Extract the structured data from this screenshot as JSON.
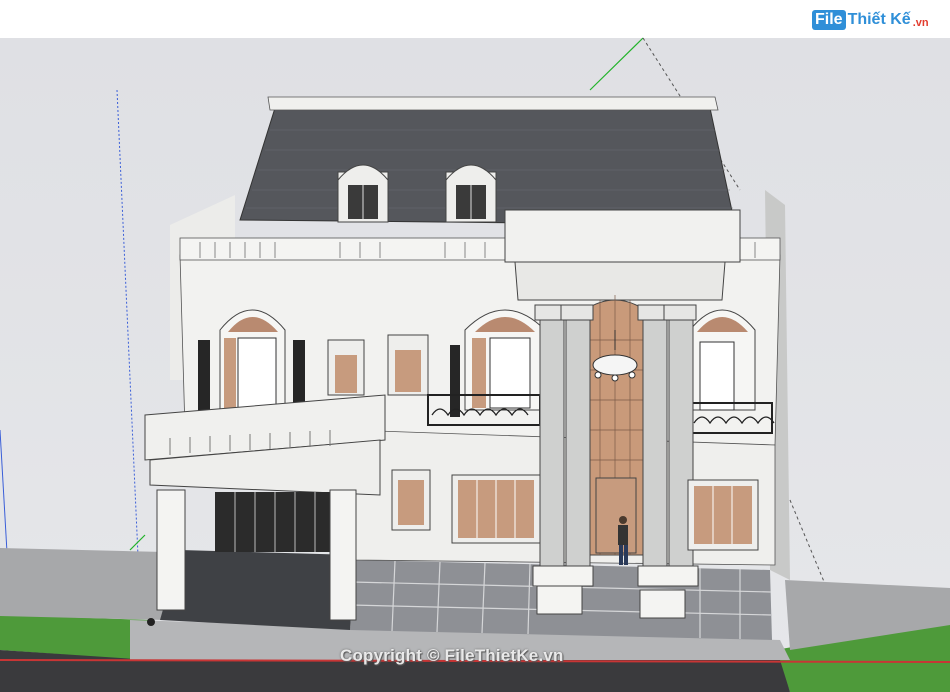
{
  "logo": {
    "badge": "File",
    "word": "Thiết Kế",
    "tld": ".vn"
  },
  "watermark": {
    "text": "Copyright © FileThietKe.vn"
  },
  "colors": {
    "roof": "#55575c",
    "wall": "#f3f3f1",
    "trim": "#d9d9d6",
    "window_warm": "#c79b7e",
    "window_dark": "#2b2b2b",
    "grass": "#4e9a3a",
    "pavement": "#8d8f93",
    "fence": "#a6a7a9"
  },
  "icons": [
    "person-figure-icon",
    "chandelier-icon",
    "origin-point-icon"
  ]
}
